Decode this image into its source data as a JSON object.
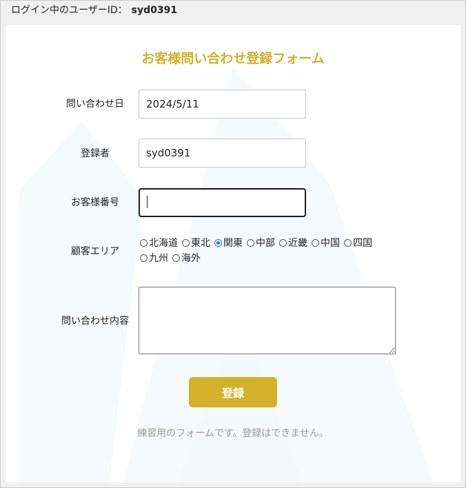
{
  "header": {
    "login_label": "ログイン中のユーザーID：",
    "user_id": "syd0391"
  },
  "form": {
    "title": "お客様問い合わせ登録フォーム",
    "inquiry_date": {
      "label": "問い合わせ日",
      "value": "2024/5/11"
    },
    "registrant": {
      "label": "登録者",
      "value": "syd0391"
    },
    "customer_number": {
      "label": "お客様番号",
      "value": "",
      "focused": true
    },
    "customer_area": {
      "label": "顧客エリア",
      "selected": "関東",
      "options": [
        "北海道",
        "東北",
        "関東",
        "中部",
        "近畿",
        "中国",
        "四国",
        "九州",
        "海外"
      ]
    },
    "inquiry_content": {
      "label": "問い合わせ内容",
      "value": ""
    },
    "submit_label": "登録",
    "notice": "練習用のフォームです。登録はできません。"
  },
  "colors": {
    "accent": "#d4b12a",
    "radio_selected": "#1a73e8",
    "notice_text": "#999999",
    "outer_background": "#f0f0f0"
  }
}
